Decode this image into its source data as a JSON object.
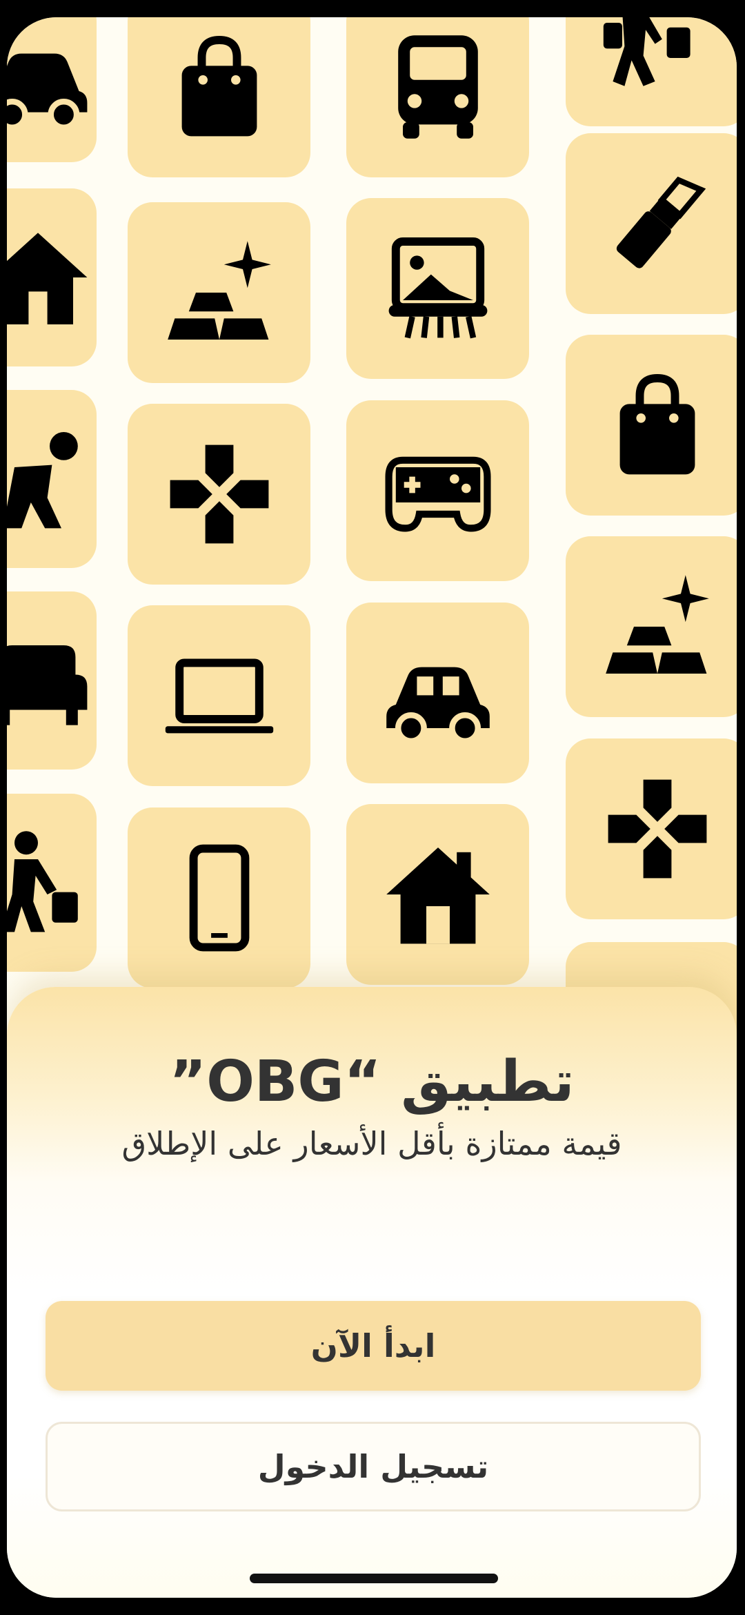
{
  "app": {
    "title": "تطبيق “OBG”",
    "subtitle": "قيمة ممتازة بأقل الأسعار على الإطلاق"
  },
  "buttons": {
    "start_label": "ابدأ الآن",
    "login_label": "تسجيل الدخول"
  },
  "background_icons": [
    "car-icon",
    "shopping-bag-icon",
    "bus-icon",
    "shopper-icon",
    "house-icon",
    "gold-bars-icon",
    "picture-cleaning-icon",
    "lipstick-icon",
    "worker-icon",
    "dpad-icon",
    "gamepad-icon",
    "shopping-bag-icon",
    "sofa-icon",
    "laptop-icon",
    "car-icon",
    "gold-bars-icon",
    "shopper-icon",
    "phone-icon",
    "house-icon",
    "dpad-icon"
  ],
  "colors": {
    "tile": "#fbe3a7",
    "background": "#fffdf3",
    "primary_button": "#f9dea3",
    "text": "#333333"
  }
}
